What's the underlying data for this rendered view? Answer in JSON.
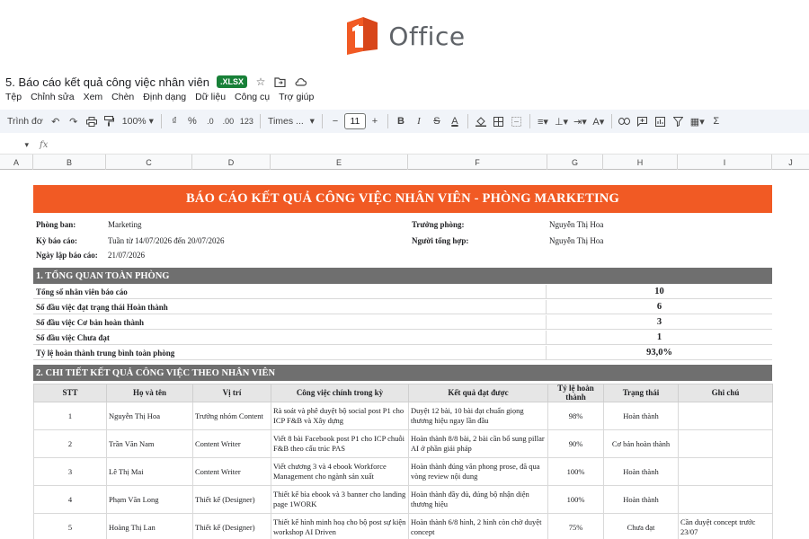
{
  "logo": {
    "text": "Office"
  },
  "titlebar": {
    "doc_title": "5. Báo cáo kết quả công việc nhân viên",
    "badge": ".XLSX"
  },
  "menu": [
    "Tệp",
    "Chỉnh sửa",
    "Xem",
    "Chèn",
    "Định dạng",
    "Dữ liệu",
    "Công cụ",
    "Trợ giúp"
  ],
  "toolbar": {
    "mode": "Trình đơ",
    "zoom": "100%",
    "currency": "₫",
    "percent": "%",
    "dec_less": ".0",
    "dec_more": ".00",
    "number_format": "123",
    "font": "Times ...",
    "font_size": "11"
  },
  "formula_bar": {
    "fx": "fx"
  },
  "columns": [
    "A",
    "B",
    "C",
    "D",
    "E",
    "F",
    "G",
    "H",
    "I",
    "J"
  ],
  "report": {
    "title": "BÁO CÁO KẾT QUẢ CÔNG VIỆC NHÂN VIÊN - PHÒNG MARKETING",
    "dept_label": "Phòng ban:",
    "dept_value": "Marketing",
    "period_label": "Kỳ báo cáo:",
    "period_value": "Tuần từ 14/07/2026 đến 20/07/2026",
    "date_label": "Ngày lập báo cáo:",
    "date_value": "21/07/2026",
    "head_label": "Trưởng phòng:",
    "head_value": "Nguyễn Thị Hoa",
    "compiler_label": "Người tổng hợp:",
    "compiler_value": "Nguyễn Thị Hoa"
  },
  "overview": {
    "title": "1. TỔNG QUAN TOÀN PHÒNG",
    "rows": [
      {
        "label": "Tổng số nhân viên báo cáo",
        "value": "10"
      },
      {
        "label": "Số đầu việc đạt trạng thái Hoàn thành",
        "value": "6"
      },
      {
        "label": "Số đầu việc Cơ bản hoàn thành",
        "value": "3"
      },
      {
        "label": "Số đầu việc Chưa đạt",
        "value": "1"
      },
      {
        "label": "Tỷ lệ hoàn thành trung bình toàn phòng",
        "value": "93,0%"
      }
    ]
  },
  "detail": {
    "title": "2. CHI TIẾT KẾT QUẢ CÔNG VIỆC THEO NHÂN VIÊN",
    "headers": [
      "STT",
      "Họ và tên",
      "Vị trí",
      "Công việc chính trong kỳ",
      "Kết quả đạt được",
      "Tỷ lệ hoàn thành",
      "Trạng thái",
      "Ghi chú"
    ],
    "rows": [
      [
        "1",
        "Nguyễn Thị Hoa",
        "Trưởng nhóm Content",
        "Rà soát và phê duyệt bộ social post P1 cho ICP F&B và Xây dựng",
        "Duyệt 12 bài, 10 bài đạt chuẩn giọng thương hiệu ngay lần đầu",
        "98%",
        "Hoàn thành",
        ""
      ],
      [
        "2",
        "Trần Văn Nam",
        "Content Writer",
        "Viết 8 bài Facebook post P1 cho ICP chuỗi F&B theo cấu trúc PAS",
        "Hoàn thành 8/8 bài, 2 bài cần bổ sung pillar AI ở phần giải pháp",
        "90%",
        "Cơ bản hoàn thành",
        ""
      ],
      [
        "3",
        "Lê Thị Mai",
        "Content Writer",
        "Viết chương 3 và 4 ebook Workforce Management cho ngành sản xuất",
        "Hoàn thành đúng văn phong prose, đã qua vòng review nội dung",
        "100%",
        "Hoàn thành",
        ""
      ],
      [
        "4",
        "Phạm Văn Long",
        "Thiết kế (Designer)",
        "Thiết kế bìa ebook và 3 banner cho landing page 1WORK",
        "Hoàn thành đầy đủ, đúng bộ nhận diện thương hiệu",
        "100%",
        "Hoàn thành",
        ""
      ],
      [
        "5",
        "Hoàng Thị Lan",
        "Thiết kế (Designer)",
        "Thiết kế hình minh hoạ cho bộ post sự kiện workshop AI Driven",
        "Hoàn thành 6/8 hình, 2 hình còn chờ duyệt concept",
        "75%",
        "Chưa đạt",
        "Cần duyệt concept trước 23/07"
      ]
    ]
  }
}
